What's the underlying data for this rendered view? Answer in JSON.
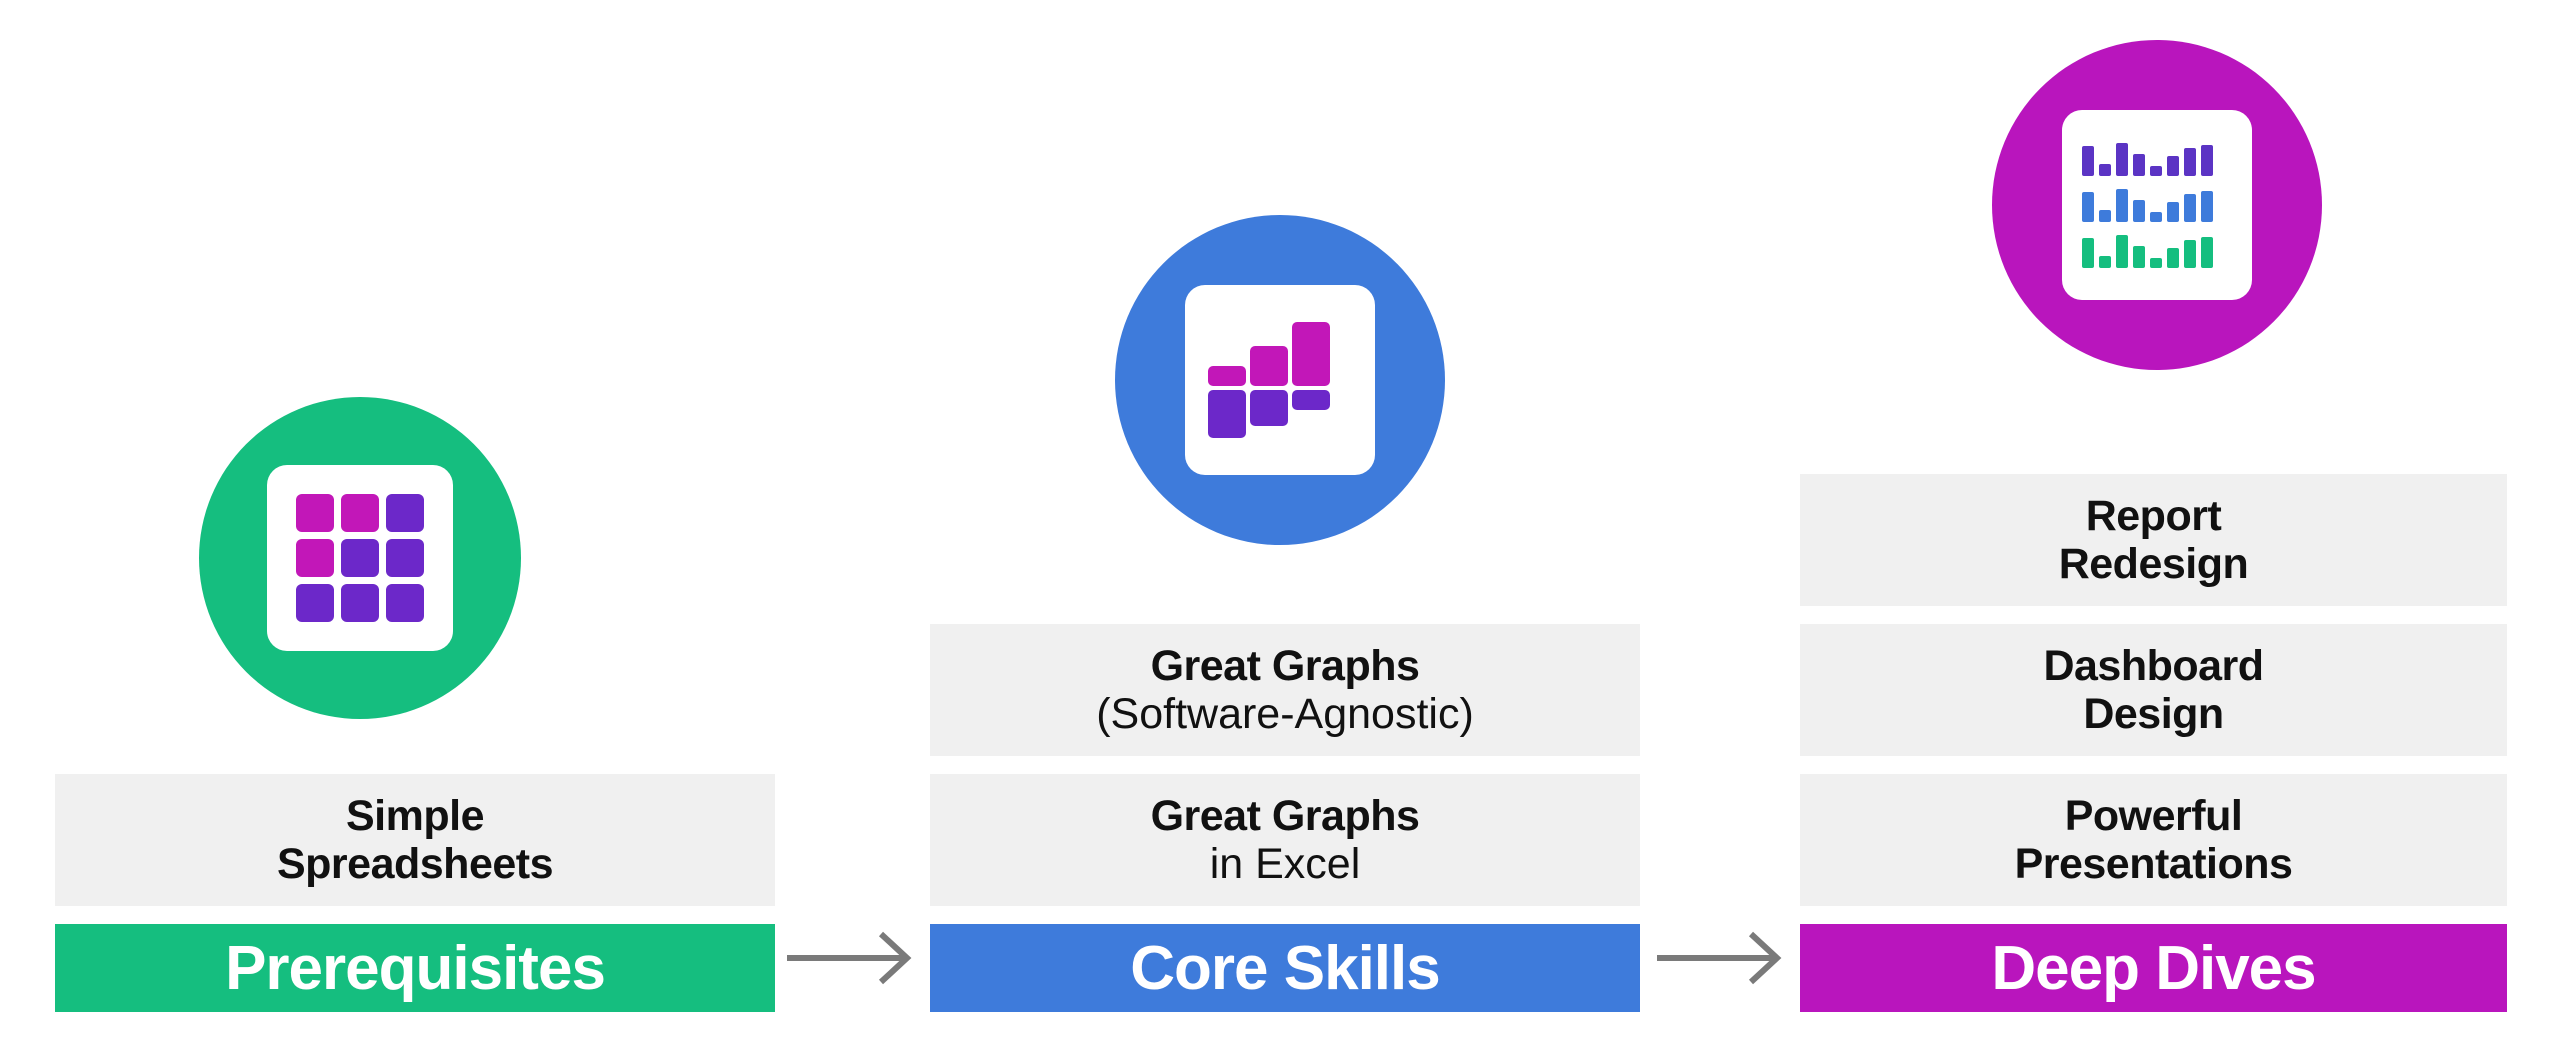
{
  "colors": {
    "prerequisites": "#15BE7F",
    "core_skills": "#3E7BDB",
    "deep_dives": "#B915BD",
    "box_bg": "#F0F0F0",
    "text": "#111111",
    "arrow": "#7A7A7A",
    "icon_magenta": "#C217B8",
    "icon_purple": "#6C28C9",
    "icon_blue": "#3E7BDB",
    "icon_green": "#15BE7F"
  },
  "columns": [
    {
      "id": "prerequisites",
      "icon": {
        "name": "spreadsheet-grid-icon",
        "type": "grid-3x3"
      },
      "items": [
        {
          "line1": "Simple",
          "line2": "Spreadsheets",
          "line2_style": "bold"
        }
      ],
      "banner": "Prerequisites"
    },
    {
      "id": "core-skills",
      "icon": {
        "name": "bar-chart-icon",
        "type": "stacked-bars"
      },
      "items": [
        {
          "line1": "Great Graphs",
          "line2": "(Software-Agnostic)",
          "line2_style": "light"
        },
        {
          "line1": "Great Graphs",
          "line2": "in Excel",
          "line2_style": "light"
        }
      ],
      "banner": "Core Skills"
    },
    {
      "id": "deep-dives",
      "icon": {
        "name": "dashboard-icon",
        "type": "dashboard-bars"
      },
      "items": [
        {
          "line1": "Report",
          "line2": "Redesign",
          "line2_style": "bold"
        },
        {
          "line1": "Dashboard",
          "line2": "Design",
          "line2_style": "bold"
        },
        {
          "line1": "Powerful",
          "line2": "Presentations",
          "line2_style": "bold"
        }
      ],
      "banner": "Deep Dives"
    }
  ],
  "arrows": [
    {
      "name": "arrow-prerequisites-to-core-skills",
      "direction": "right"
    },
    {
      "name": "arrow-core-skills-to-deep-dives",
      "direction": "right"
    }
  ],
  "icon_grid_cells": [
    "#C217B8",
    "#C217B8",
    "#6C28C9",
    "#C217B8",
    "#6C28C9",
    "#6C28C9",
    "#6C28C9",
    "#6C28C9",
    "#6C28C9"
  ],
  "icon_dashboard_rows": [
    {
      "color": "#5B34C4",
      "heights": [
        30,
        12,
        33,
        22,
        10,
        20,
        28,
        31
      ]
    },
    {
      "color": "#3E7BDB",
      "heights": [
        30,
        12,
        33,
        22,
        10,
        20,
        28,
        31
      ]
    },
    {
      "color": "#15BE7F",
      "heights": [
        30,
        12,
        33,
        22,
        10,
        20,
        28,
        31
      ]
    }
  ]
}
